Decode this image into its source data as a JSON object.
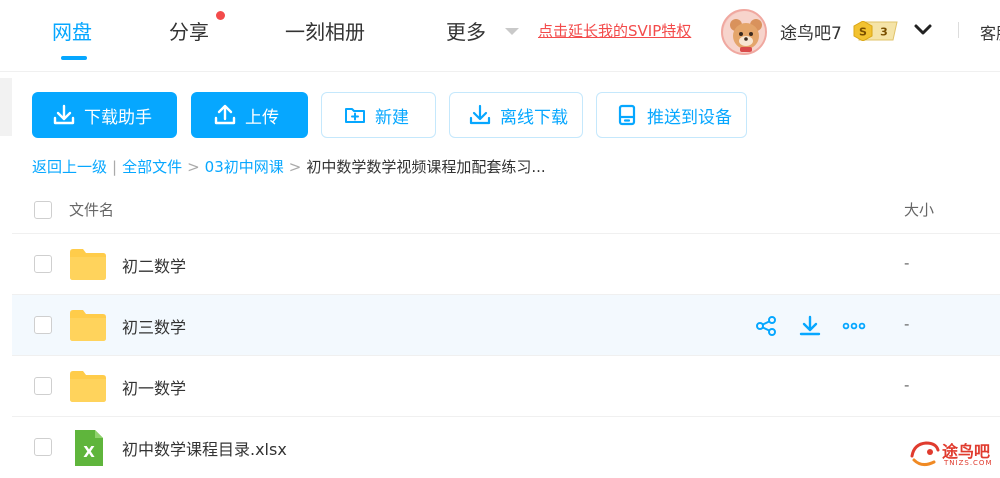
{
  "nav": {
    "items": [
      {
        "label": "网盘",
        "active": true
      },
      {
        "label": "分享",
        "badge_dot": true
      },
      {
        "label": "一刻相册"
      },
      {
        "label": "更多",
        "has_dropdown": true
      }
    ],
    "promo_link": "点击延长我的SVIP特权"
  },
  "user": {
    "name": "途鸟吧7",
    "vip_letter": "S",
    "vip_level": "3",
    "cut_text": "客服"
  },
  "toolbar": {
    "download_helper": "下载助手",
    "upload": "上传",
    "new": "新建",
    "offline_download": "离线下载",
    "push_to_device": "推送到设备"
  },
  "breadcrumb": {
    "back": "返回上一级",
    "divider": "|",
    "all_files": "全部文件",
    "arrow": ">",
    "folder1": "03初中网课",
    "current": "初中数学数学视频课程加配套练习..."
  },
  "table": {
    "col_name": "文件名",
    "col_size": "大小",
    "rows": [
      {
        "name": "初二数学",
        "type": "folder",
        "size": "-"
      },
      {
        "name": "初三数学",
        "type": "folder",
        "size": "-",
        "hovered": true
      },
      {
        "name": "初一数学",
        "type": "folder",
        "size": "-"
      },
      {
        "name": "初中数学课程目录.xlsx",
        "type": "xlsx",
        "size": ""
      }
    ],
    "xlsx_letter": "X"
  },
  "watermark": {
    "text": "途鸟吧",
    "sub": "TNIZS.COM"
  },
  "colors": {
    "accent": "#06a7ff",
    "promo": "#f34b4b",
    "folder": "#ffcc4a",
    "xlsx": "#5fb53c",
    "hover_row": "#f3f9fe"
  }
}
